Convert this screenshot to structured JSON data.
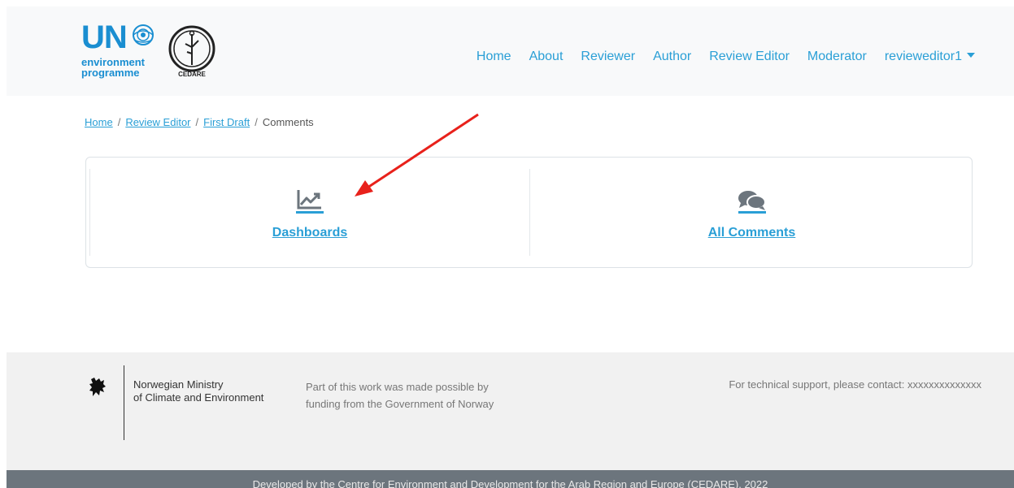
{
  "header": {
    "logo_un": {
      "letters": "UN",
      "line1": "environment",
      "line2": "programme"
    },
    "logo_cedare": {
      "text": "CEDARE"
    },
    "nav": [
      {
        "label": "Home"
      },
      {
        "label": "About"
      },
      {
        "label": "Reviewer"
      },
      {
        "label": "Author"
      },
      {
        "label": "Review Editor"
      },
      {
        "label": "Moderator"
      },
      {
        "label": "revieweditor1"
      }
    ]
  },
  "breadcrumb": {
    "items": [
      {
        "label": "Home",
        "link": true
      },
      {
        "label": "Review Editor",
        "link": true
      },
      {
        "label": "First Draft",
        "link": true
      },
      {
        "label": "Comments",
        "link": false
      }
    ],
    "separator": "/"
  },
  "panels": [
    {
      "label": "Dashboards",
      "icon": "chart-line-icon"
    },
    {
      "label": "All Comments",
      "icon": "comments-icon"
    }
  ],
  "footer": {
    "ministry_line1": "Norwegian Ministry",
    "ministry_line2": "of Climate and Environment",
    "funding_line1": "Part of this work was made possible by",
    "funding_line2": "funding from the Government of Norway",
    "support": "For technical support, please contact: xxxxxxxxxxxxxx",
    "credit": "Developed by the Centre for Environment and Development for the Arab Region and Europe (CEDARE), 2022"
  },
  "colors": {
    "link": "#2a9fd6",
    "un_blue": "#1a8ed1",
    "annotation_arrow": "#e8211b",
    "footer_bg": "#f1f1f1",
    "bottom_bar": "#6c757d"
  }
}
